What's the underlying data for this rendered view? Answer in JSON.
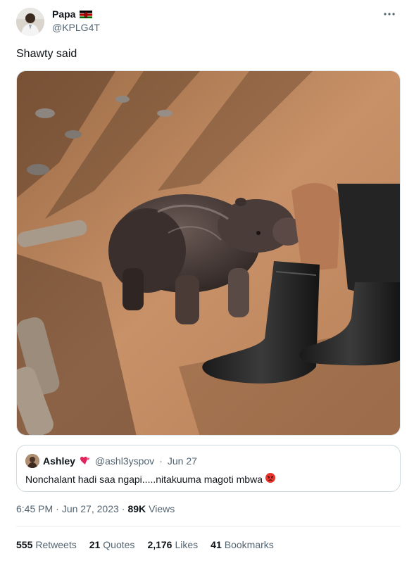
{
  "author": {
    "name": "Papa",
    "handle": "@KPLG4T",
    "flag_icon": "kenya-flag-icon"
  },
  "tweet": {
    "text": "Shawty said"
  },
  "quote": {
    "name": "Ashley",
    "handle": "@ashl3yspov",
    "date": "Jun 27",
    "text": "Nonchalant hadi saa ngapi.....nitakuuma magoti mbwa",
    "name_emoji_icon": "two-hearts-emoji-icon",
    "text_emoji_icon": "angry-face-emoji-icon"
  },
  "meta": {
    "time": "6:45 PM",
    "date": "Jun 27, 2023",
    "views_count": "89K",
    "views_label": "Views",
    "separator": "·"
  },
  "stats": {
    "retweets_count": "555",
    "retweets_label": "Retweets",
    "quotes_count": "21",
    "quotes_label": "Quotes",
    "likes_count": "2,176",
    "likes_label": "Likes",
    "bookmarks_count": "41",
    "bookmarks_label": "Bookmarks"
  },
  "colors": {
    "text_primary": "#0f1419",
    "text_secondary": "#536471",
    "border": "#cfd9de",
    "divider": "#eff3f4"
  }
}
